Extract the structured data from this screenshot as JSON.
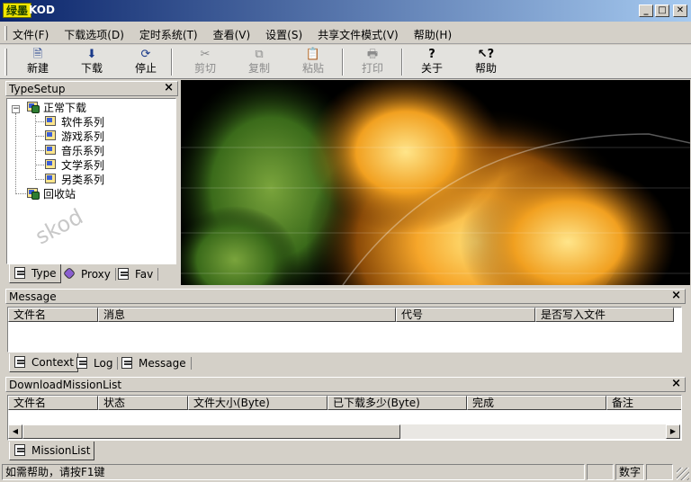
{
  "window": {
    "app_icon_text": "绿墨",
    "title": "KOD"
  },
  "menu": [
    {
      "label": "文件(F)"
    },
    {
      "label": "下载选项(D)"
    },
    {
      "label": "定时系统(T)"
    },
    {
      "label": "查看(V)"
    },
    {
      "label": "设置(S)"
    },
    {
      "label": "共享文件模式(V)"
    },
    {
      "label": "帮助(H)"
    }
  ],
  "toolbar": {
    "new": "新建",
    "download": "下载",
    "stop": "停止",
    "cut": "剪切",
    "copy": "复制",
    "paste": "粘贴",
    "print": "打印",
    "about": "关于",
    "help": "帮助"
  },
  "type_setup": {
    "title": "TypeSetup",
    "root": "正常下载",
    "children": [
      "软件系列",
      "游戏系列",
      "音乐系列",
      "文学系列",
      "另类系列"
    ],
    "recycle": "回收站",
    "watermark": "skod",
    "tabs": [
      "Type",
      "Proxy",
      "Fav"
    ]
  },
  "message": {
    "title": "Message",
    "columns": [
      "文件名",
      "消息",
      "代号",
      "是否写入文件"
    ],
    "tabs": [
      "Context",
      "Log",
      "Message"
    ]
  },
  "missions": {
    "title": "DownloadMissionList",
    "columns": [
      "文件名",
      "状态",
      "文件大小(Byte)",
      "已下载多少(Byte)",
      "完成",
      "备注"
    ],
    "tab": "MissionList"
  },
  "status": {
    "help": "如需帮助，请按F1键",
    "numlock": "数字"
  }
}
